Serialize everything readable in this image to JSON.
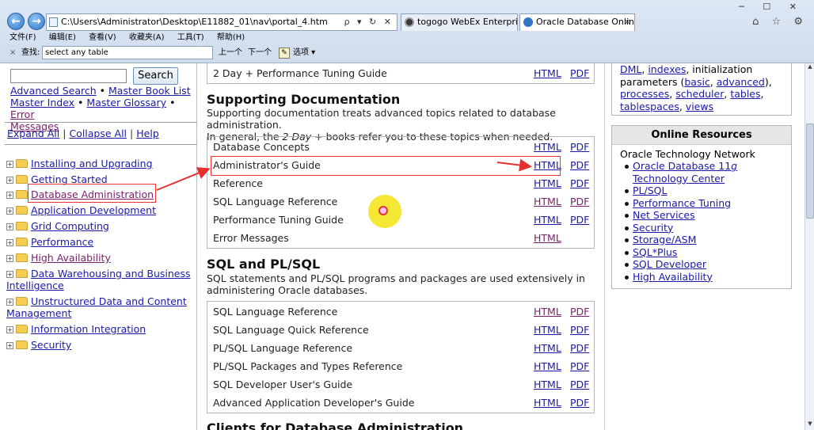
{
  "browser": {
    "address": "C:\\Users\\Administrator\\Desktop\\E11882_01\\nav\\portal_4.htm",
    "address_tools": "ρ ▾ ↻ ✕",
    "tabs": [
      {
        "label": "togogo WebEx Enterprise ..."
      },
      {
        "label": "Oracle Database Online ..."
      }
    ],
    "window_controls": "─ ☐ ✕",
    "fav_icons": "⌂ ☆ ⚙",
    "menu": [
      "文件(F)",
      "编辑(E)",
      "查看(V)",
      "收藏夹(A)",
      "工具(T)",
      "帮助(H)"
    ],
    "find": {
      "close": "×",
      "label": "查找:",
      "value": "select any table",
      "prev": "上一个",
      "next": "下一个",
      "options": "选项 ▾"
    }
  },
  "left": {
    "search_button": "Search",
    "links": [
      "Advanced Search",
      "Master Book List",
      "Master Index",
      "Master Glossary",
      "Error Messages"
    ],
    "expand_all": "Expand All",
    "collapse_all": "Collapse All",
    "help": "Help",
    "tree": [
      "Installing and Upgrading",
      "Getting Started",
      "Database Administration",
      "Application Development",
      "Grid Computing",
      "Performance",
      "High Availability",
      "Data Warehousing and Business Intelligence",
      "Unstructured Data and Content Management",
      "Information Integration",
      "Security"
    ]
  },
  "main": {
    "top_row": {
      "name": "2 Day + Performance Tuning Guide",
      "html": "HTML",
      "pdf": "PDF"
    },
    "supporting": {
      "title": "Supporting Documentation",
      "desc1": "Supporting documentation treats advanced topics related to database administration.",
      "desc2a": "In general, the ",
      "desc2b": "2 Day +",
      "desc2c": " books refer you to these topics when needed.",
      "rows": [
        {
          "name": "Database Concepts",
          "html": "HTML",
          "pdf": "PDF"
        },
        {
          "name": "Administrator's Guide",
          "html": "HTML",
          "pdf": "PDF"
        },
        {
          "name": "Reference",
          "html": "HTML",
          "pdf": "PDF"
        },
        {
          "name": "SQL Language Reference",
          "html": "HTML",
          "pdf": "PDF"
        },
        {
          "name": "Performance Tuning Guide",
          "html": "HTML",
          "pdf": "PDF"
        },
        {
          "name": "Error Messages",
          "html": "HTML",
          "pdf": ""
        }
      ]
    },
    "sqlplsql": {
      "title": "SQL and PL/SQL",
      "desc1": "SQL statements and PL/SQL programs and packages are used extensively in",
      "desc2": "administering Oracle databases.",
      "rows": [
        {
          "name": "SQL Language Reference",
          "html": "HTML",
          "pdf": "PDF"
        },
        {
          "name": "SQL Language Quick Reference",
          "html": "HTML",
          "pdf": "PDF"
        },
        {
          "name": "PL/SQL Language Reference",
          "html": "HTML",
          "pdf": "PDF"
        },
        {
          "name": "PL/SQL Packages and Types Reference",
          "html": "HTML",
          "pdf": "PDF"
        },
        {
          "name": "SQL Developer User's Guide",
          "html": "HTML",
          "pdf": "PDF"
        },
        {
          "name": "Advanced Application Developer's Guide",
          "html": "HTML",
          "pdf": "PDF"
        }
      ]
    },
    "next_title": "Clients for Database Administration"
  },
  "right": {
    "top": {
      "dml": "DML",
      "comma1": ", ",
      "indexes": "indexes",
      "init": ", initialization",
      "params": "parameters (",
      "basic": "basic",
      "comma2": ", ",
      "advanced": "advanced",
      "close": "),",
      "processes": "processes",
      "comma3": ", ",
      "scheduler": "scheduler",
      "comma4": ", ",
      "tables": "tables",
      "comma5": ",",
      "tablespaces": "tablespaces",
      "comma6": ", ",
      "views": "views"
    },
    "online_resources": {
      "title": "Online Resources",
      "otn": "Oracle Technology Network",
      "first_item_a": "Oracle Database 11",
      "first_item_b": "g",
      "first_item_c": "Technology Center",
      "items": [
        "PL/SQL",
        "Performance Tuning",
        "Net Services",
        "Security",
        "Storage/ASM",
        "SQL*Plus",
        "SQL Developer",
        "High Availability"
      ]
    }
  },
  "overlay": {
    "arrow_color": "#e53030",
    "highlight_color": "#f5e61f"
  }
}
